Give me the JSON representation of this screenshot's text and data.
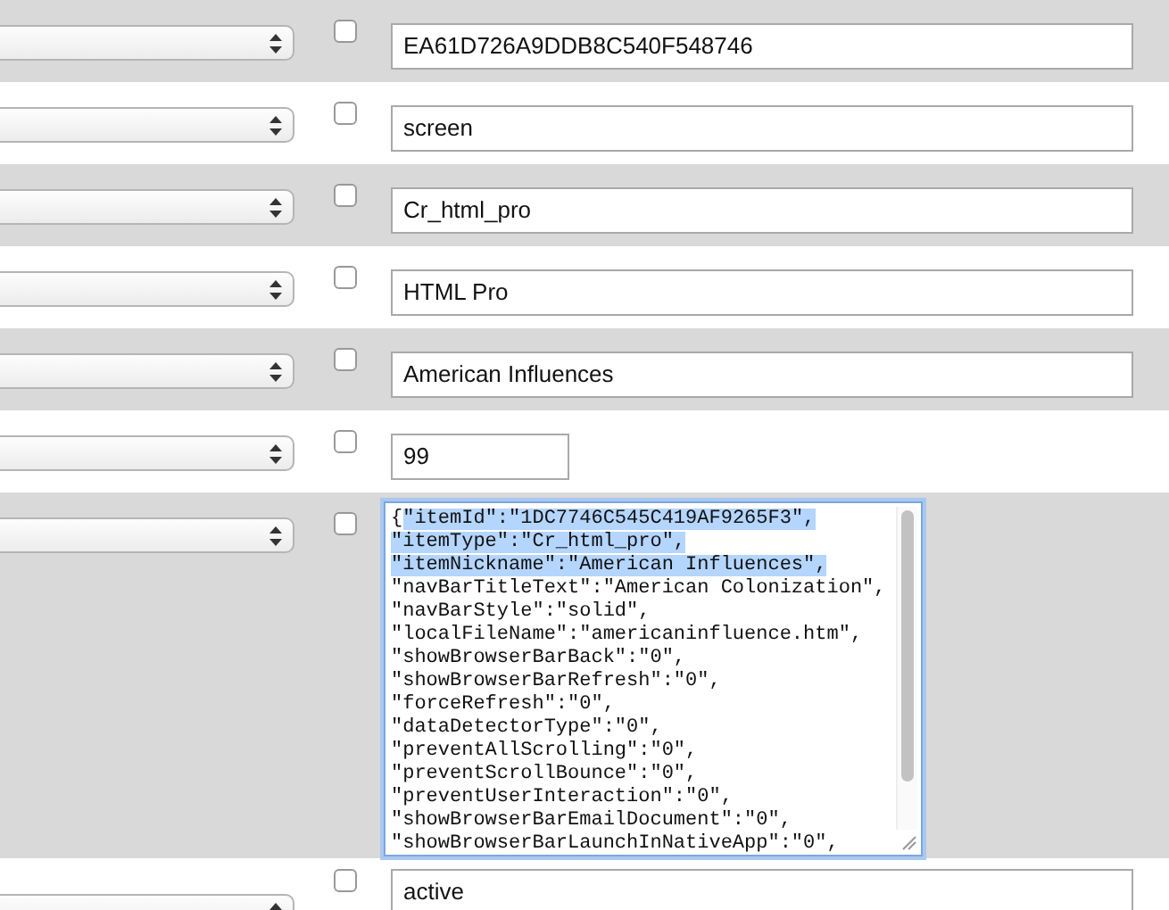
{
  "rows": [
    {
      "kind": "text",
      "checked": false,
      "value": "EA61D726A9DDB8C540F548746"
    },
    {
      "kind": "text",
      "checked": false,
      "value": "screen"
    },
    {
      "kind": "text",
      "checked": false,
      "value": "Cr_html_pro"
    },
    {
      "kind": "text",
      "checked": false,
      "value": "HTML Pro"
    },
    {
      "kind": "text",
      "checked": false,
      "value": "American Influences"
    },
    {
      "kind": "short",
      "checked": false,
      "value": "99"
    },
    {
      "kind": "json",
      "checked": false,
      "segments": [
        {
          "text": "{",
          "selected": false
        },
        {
          "text": "\"itemId\":\"1DC7746C545C419AF9265F3\",\n\"itemType\":\"Cr_html_pro\",\n\"itemNickname\":\"American Influences\",",
          "selected": true
        },
        {
          "text": "\n\"navBarTitleText\":\"American Colonization\",\n\"navBarStyle\":\"solid\",\n\"localFileName\":\"americaninfluence.htm\",\n\"showBrowserBarBack\":\"0\",\n\"showBrowserBarRefresh\":\"0\",\n\"forceRefresh\":\"0\",\n\"dataDetectorType\":\"0\",\n\"preventAllScrolling\":\"0\",\n\"preventScrollBounce\":\"0\",\n\"preventUserInteraction\":\"0\",\n\"showBrowserBarEmailDocument\":\"0\",\n\"showBrowserBarLaunchInNativeApp\":\"0\",",
          "selected": false
        }
      ]
    },
    {
      "kind": "text",
      "checked": false,
      "value": "active"
    }
  ]
}
